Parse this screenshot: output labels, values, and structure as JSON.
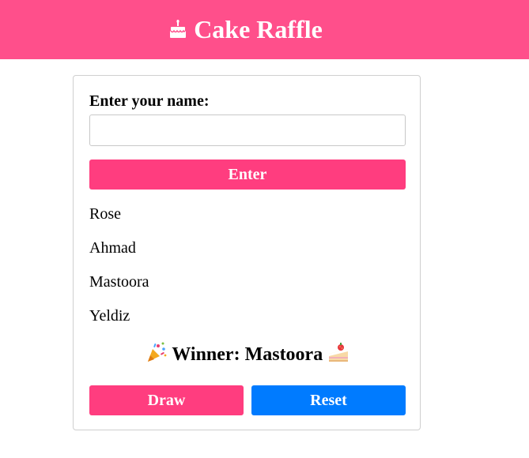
{
  "header": {
    "icon": "birthday-cake-icon",
    "title": "Cake Raffle",
    "background": "#ff4f8b"
  },
  "form": {
    "label": "Enter your name:",
    "input_value": "",
    "input_placeholder": "",
    "enter_label": "Enter"
  },
  "participants": [
    "Rose",
    "Ahmad",
    "Mastoora",
    "Yeldiz"
  ],
  "result": {
    "prefix_icon": "party-popper-icon",
    "text": "Winner: Mastoora",
    "suffix_icon": "shortcake-icon"
  },
  "actions": {
    "draw_label": "Draw",
    "reset_label": "Reset"
  },
  "colors": {
    "pink_button": "#ff3d7f",
    "blue_button": "#007bff"
  }
}
